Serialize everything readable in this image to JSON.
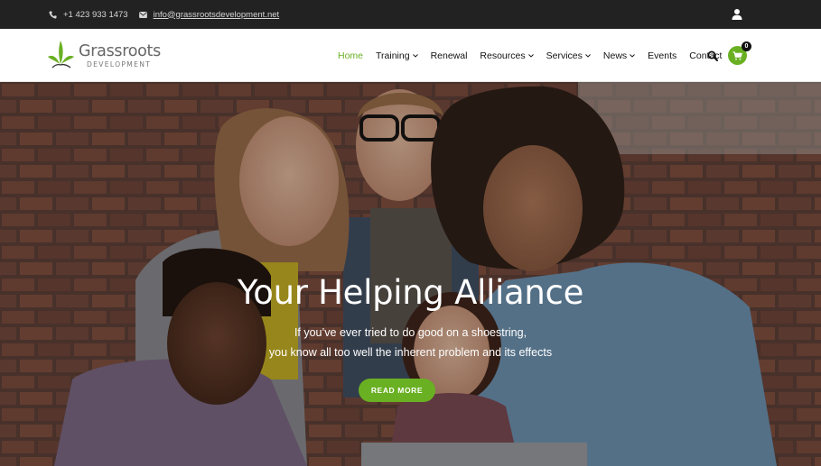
{
  "topbar": {
    "phone": "+1 423 933 1473",
    "email": "info@grassrootsdevelopment.net",
    "phone_icon": "phone-icon",
    "email_icon": "envelope-icon",
    "user_icon": "user-icon"
  },
  "brand": {
    "name": "Grassroots",
    "sub": "DEVELOPMENT",
    "logo_icon": "leaf-logo-icon"
  },
  "nav": {
    "items": [
      {
        "label": "Home",
        "active": true,
        "dropdown": false
      },
      {
        "label": "Training",
        "active": false,
        "dropdown": true
      },
      {
        "label": "Renewal",
        "active": false,
        "dropdown": false
      },
      {
        "label": "Resources",
        "active": false,
        "dropdown": true
      },
      {
        "label": "Services",
        "active": false,
        "dropdown": true
      },
      {
        "label": "News",
        "active": false,
        "dropdown": true
      },
      {
        "label": "Events",
        "active": false,
        "dropdown": false
      },
      {
        "label": "Contact",
        "active": false,
        "dropdown": false
      }
    ],
    "search_icon": "search-icon",
    "cart_icon": "cart-icon",
    "cart_count": "0"
  },
  "hero": {
    "title": "Your Helping Alliance",
    "line1": "If you’ve ever tried to do good on a shoestring,",
    "line2": "you know all too well the inherent problem and its effects",
    "button": "READ MORE"
  },
  "colors": {
    "accent": "#6ab023",
    "topbar_bg": "#222222",
    "text_dark": "#111111"
  }
}
